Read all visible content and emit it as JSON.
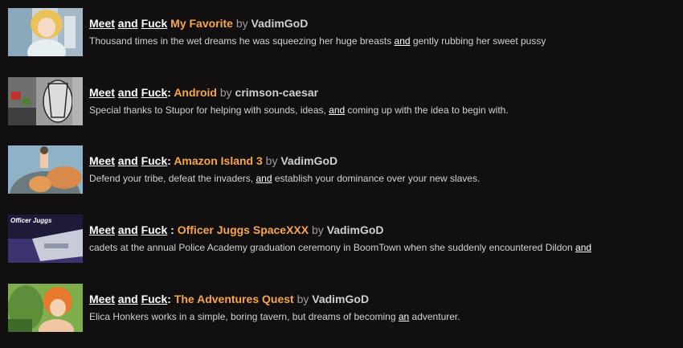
{
  "items": [
    {
      "kw1": "Meet",
      "kw2": "and",
      "kw3": "Fuck",
      "sep": " ",
      "game": "My Favorite",
      "by": "by",
      "author": "VadimGoD",
      "desc_pre": "Thousand times in the wet dreams he was squeezing her huge breasts ",
      "desc_hl": "and",
      "desc_post": " gently rubbing her sweet pussy"
    },
    {
      "kw1": "Meet",
      "kw2": "and",
      "kw3": "Fuck",
      "sep": ": ",
      "game": "Android",
      "by": "by",
      "author": "crimson-caesar",
      "desc_pre": "Special thanks to Stupor for helping with sounds, ideas, ",
      "desc_hl": "and",
      "desc_post": " coming up with the idea to begin with."
    },
    {
      "kw1": "Meet",
      "kw2": "and",
      "kw3": "Fuck",
      "sep": ": ",
      "game": "Amazon Island 3",
      "by": "by",
      "author": "VadimGoD",
      "desc_pre": "Defend your tribe, defeat the invaders, ",
      "desc_hl": "and",
      "desc_post": " establish your dominance over your new slaves."
    },
    {
      "kw1": "Meet",
      "kw2": "and",
      "kw3": "Fuck",
      "sep": " : ",
      "game": "Officer Juggs SpaceXXX",
      "by": "by",
      "author": "VadimGoD",
      "desc_pre": "cadets at the annual Police Academy graduation ceremony in BoomTown when she suddenly encountered Dildon ",
      "desc_hl": "and",
      "desc_post": ""
    },
    {
      "kw1": "Meet",
      "kw2": "and",
      "kw3": "Fuck",
      "sep": ": ",
      "game": "The Adventures Quest",
      "by": "by",
      "author": "VadimGoD",
      "desc_pre": "Elica Honkers works in a simple, boring tavern, but dreams of becoming ",
      "desc_hl": "an",
      "desc_post": " adventurer."
    }
  ],
  "thumb_logo_text": "Officer Juggs"
}
